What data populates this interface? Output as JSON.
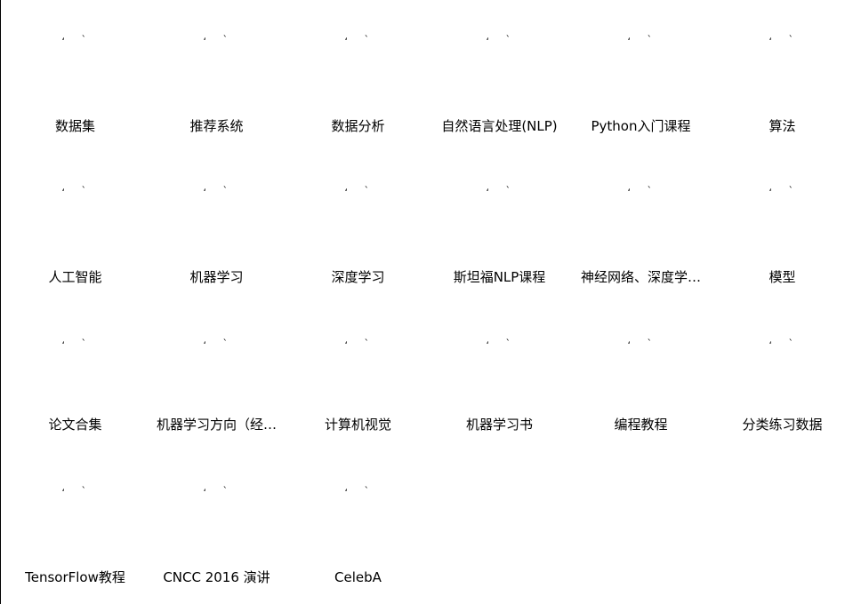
{
  "tags": [
    {
      "label": "数据集"
    },
    {
      "label": "推荐系统"
    },
    {
      "label": "数据分析"
    },
    {
      "label": "自然语言处理(NLP)"
    },
    {
      "label": "Python入门课程"
    },
    {
      "label": "算法"
    },
    {
      "label": "人工智能"
    },
    {
      "label": "机器学习"
    },
    {
      "label": "深度学习"
    },
    {
      "label": "斯坦福NLP课程"
    },
    {
      "label": "神经网络、深度学…"
    },
    {
      "label": "模型"
    },
    {
      "label": "论文合集"
    },
    {
      "label": "机器学习方向（经…"
    },
    {
      "label": "计算机视觉"
    },
    {
      "label": "机器学习书"
    },
    {
      "label": "编程教程"
    },
    {
      "label": "分类练习数据"
    },
    {
      "label": "TensorFlow教程"
    },
    {
      "label": "CNCC 2016 演讲"
    },
    {
      "label": "CelebA"
    }
  ],
  "icon_glyphs": {
    "left": "ʻ",
    "right": "ˋ"
  },
  "icon_name": "broken-image-icon"
}
